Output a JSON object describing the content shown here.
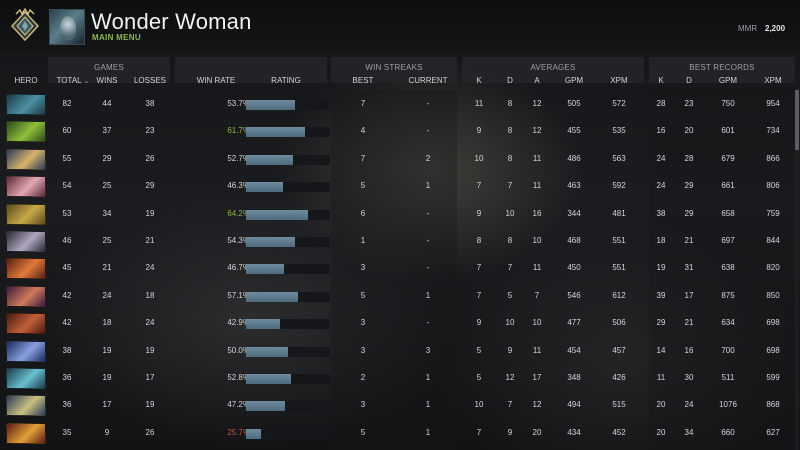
{
  "header": {
    "title": "Wonder Woman",
    "subtitle": "MAIN MENU",
    "mmr_label": "MMR",
    "mmr_value": "2,200"
  },
  "groups": {
    "games": "GAMES",
    "win_streaks": "WIN STREAKS",
    "averages": "AVERAGES",
    "best_records": "BEST RECORDS"
  },
  "columns": {
    "hero": "HERO",
    "total": "TOTAL",
    "sort_arrow": "⌄",
    "wins": "WINS",
    "losses": "LOSSES",
    "win_rate": "WIN RATE",
    "rating": "RATING",
    "best": "BEST",
    "current": "CURRENT",
    "k": "K",
    "d": "D",
    "a": "A",
    "gpm": "GPM",
    "xpm": "XPM",
    "best_k": "K",
    "best_d": "D",
    "best_gpm": "GPM",
    "best_xpm": "XPM"
  },
  "colors": {
    "winrate_high": "#8ab84a",
    "winrate_mid": "#d3d6da",
    "winrate_low": "#c0504d",
    "bar": "#5b7788"
  },
  "rows": [
    {
      "hero_icon": "hero-portrait-1",
      "portrait": [
        "#1d3a45",
        "#4c8fa3"
      ],
      "total": "82",
      "wins": "44",
      "losses": "38",
      "win_rate": "53.7%",
      "rate_value": 0.537,
      "rating": 0.58,
      "best": "7",
      "current": "-",
      "k": "11",
      "d": "8",
      "a": "12",
      "gpm": "505",
      "xpm": "572",
      "best_k": "28",
      "best_d": "23",
      "best_gpm": "750",
      "best_xpm": "954"
    },
    {
      "hero_icon": "hero-portrait-2",
      "portrait": [
        "#2e4a1c",
        "#8fbf3a"
      ],
      "total": "60",
      "wins": "37",
      "losses": "23",
      "win_rate": "61.7%",
      "rate_value": 0.617,
      "rating": 0.7,
      "best": "4",
      "current": "-",
      "k": "9",
      "d": "8",
      "a": "12",
      "gpm": "455",
      "xpm": "535",
      "best_k": "16",
      "best_d": "20",
      "best_gpm": "601",
      "best_xpm": "734"
    },
    {
      "hero_icon": "hero-portrait-3",
      "portrait": [
        "#2a3a5a",
        "#d9b36a"
      ],
      "total": "55",
      "wins": "29",
      "losses": "26",
      "win_rate": "52.7%",
      "rate_value": 0.527,
      "rating": 0.56,
      "best": "7",
      "current": "2",
      "k": "10",
      "d": "8",
      "a": "11",
      "gpm": "486",
      "xpm": "563",
      "best_k": "24",
      "best_d": "28",
      "best_gpm": "679",
      "best_xpm": "866"
    },
    {
      "hero_icon": "hero-portrait-4",
      "portrait": [
        "#5a2a3a",
        "#e3a7b0"
      ],
      "total": "54",
      "wins": "25",
      "losses": "29",
      "win_rate": "46.3%",
      "rate_value": 0.463,
      "rating": 0.44,
      "best": "5",
      "current": "1",
      "k": "7",
      "d": "7",
      "a": "11",
      "gpm": "463",
      "xpm": "592",
      "best_k": "24",
      "best_d": "29",
      "best_gpm": "661",
      "best_xpm": "806"
    },
    {
      "hero_icon": "hero-portrait-5",
      "portrait": [
        "#5a4a1c",
        "#c9a84a"
      ],
      "total": "53",
      "wins": "34",
      "losses": "19",
      "win_rate": "64.2%",
      "rate_value": 0.642,
      "rating": 0.74,
      "best": "6",
      "current": "-",
      "k": "9",
      "d": "10",
      "a": "16",
      "gpm": "344",
      "xpm": "481",
      "best_k": "38",
      "best_d": "29",
      "best_gpm": "658",
      "best_xpm": "759"
    },
    {
      "hero_icon": "hero-portrait-6",
      "portrait": [
        "#2a2a35",
        "#b0a8c0"
      ],
      "total": "46",
      "wins": "25",
      "losses": "21",
      "win_rate": "54.3%",
      "rate_value": 0.543,
      "rating": 0.58,
      "best": "1",
      "current": "-",
      "k": "8",
      "d": "8",
      "a": "10",
      "gpm": "468",
      "xpm": "551",
      "best_k": "18",
      "best_d": "21",
      "best_gpm": "697",
      "best_xpm": "844"
    },
    {
      "hero_icon": "hero-portrait-7",
      "portrait": [
        "#5a1e12",
        "#e07a3a"
      ],
      "total": "45",
      "wins": "21",
      "losses": "24",
      "win_rate": "46.7%",
      "rate_value": 0.467,
      "rating": 0.45,
      "best": "3",
      "current": "-",
      "k": "7",
      "d": "7",
      "a": "11",
      "gpm": "450",
      "xpm": "551",
      "best_k": "19",
      "best_d": "31",
      "best_gpm": "638",
      "best_xpm": "820"
    },
    {
      "hero_icon": "hero-portrait-8",
      "portrait": [
        "#3a1a40",
        "#d07a5a"
      ],
      "total": "42",
      "wins": "24",
      "losses": "18",
      "win_rate": "57.1%",
      "rate_value": 0.571,
      "rating": 0.62,
      "best": "5",
      "current": "1",
      "k": "7",
      "d": "5",
      "a": "7",
      "gpm": "546",
      "xpm": "612",
      "best_k": "39",
      "best_d": "17",
      "best_gpm": "875",
      "best_xpm": "850"
    },
    {
      "hero_icon": "hero-portrait-9",
      "portrait": [
        "#4a1a12",
        "#c0603a"
      ],
      "total": "42",
      "wins": "18",
      "losses": "24",
      "win_rate": "42.9%",
      "rate_value": 0.429,
      "rating": 0.4,
      "best": "3",
      "current": "-",
      "k": "9",
      "d": "10",
      "a": "10",
      "gpm": "477",
      "xpm": "506",
      "best_k": "29",
      "best_d": "21",
      "best_gpm": "634",
      "best_xpm": "698"
    },
    {
      "hero_icon": "hero-portrait-10",
      "portrait": [
        "#1a2a5a",
        "#8aa0e0"
      ],
      "total": "38",
      "wins": "19",
      "losses": "19",
      "win_rate": "50.0%",
      "rate_value": 0.5,
      "rating": 0.5,
      "best": "3",
      "current": "3",
      "k": "5",
      "d": "9",
      "a": "11",
      "gpm": "454",
      "xpm": "457",
      "best_k": "14",
      "best_d": "16",
      "best_gpm": "700",
      "best_xpm": "698"
    },
    {
      "hero_icon": "hero-portrait-11",
      "portrait": [
        "#1a3a4a",
        "#6ac0d0"
      ],
      "total": "36",
      "wins": "19",
      "losses": "17",
      "win_rate": "52.8%",
      "rate_value": 0.528,
      "rating": 0.54,
      "best": "2",
      "current": "1",
      "k": "5",
      "d": "12",
      "a": "17",
      "gpm": "348",
      "xpm": "426",
      "best_k": "11",
      "best_d": "30",
      "best_gpm": "511",
      "best_xpm": "599"
    },
    {
      "hero_icon": "hero-portrait-12",
      "portrait": [
        "#2a3a5a",
        "#c9c080"
      ],
      "total": "36",
      "wins": "17",
      "losses": "19",
      "win_rate": "47.2%",
      "rate_value": 0.472,
      "rating": 0.46,
      "best": "3",
      "current": "1",
      "k": "10",
      "d": "7",
      "a": "12",
      "gpm": "494",
      "xpm": "515",
      "best_k": "20",
      "best_d": "24",
      "best_gpm": "1076",
      "best_xpm": "868"
    },
    {
      "hero_icon": "hero-portrait-13",
      "portrait": [
        "#5a1a12",
        "#e0a03a"
      ],
      "total": "35",
      "wins": "9",
      "losses": "26",
      "win_rate": "25.7%",
      "rate_value": 0.257,
      "rating": 0.18,
      "best": "5",
      "current": "1",
      "k": "7",
      "d": "9",
      "a": "20",
      "gpm": "434",
      "xpm": "452",
      "best_k": "20",
      "best_d": "34",
      "best_gpm": "660",
      "best_xpm": "627"
    }
  ]
}
